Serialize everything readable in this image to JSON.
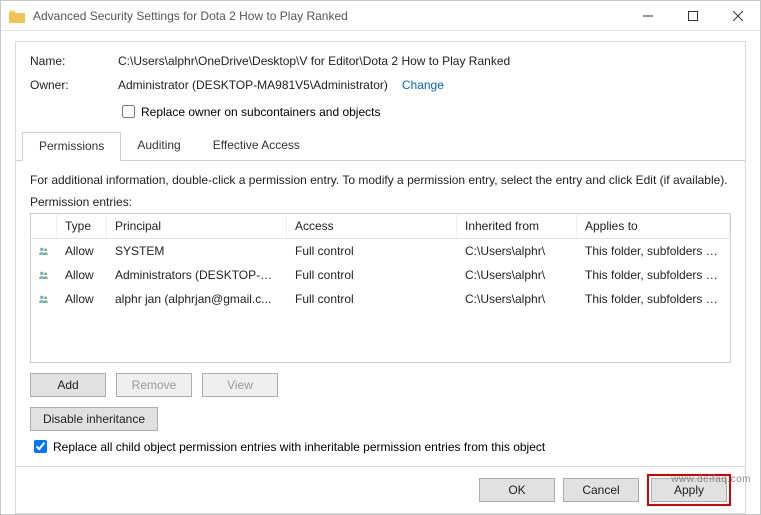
{
  "window": {
    "title": "Advanced Security Settings for Dota 2 How to Play Ranked"
  },
  "meta": {
    "name_label": "Name:",
    "name_value": "C:\\Users\\alphr\\OneDrive\\Desktop\\V for Editor\\Dota 2 How to Play Ranked",
    "owner_label": "Owner:",
    "owner_value": "Administrator (DESKTOP-MA981V5\\Administrator)",
    "change_link": "Change",
    "replace_owner_label": "Replace owner on subcontainers and objects"
  },
  "tabs": {
    "permissions": "Permissions",
    "auditing": "Auditing",
    "effective": "Effective Access"
  },
  "info_text": "For additional information, double-click a permission entry. To modify a permission entry, select the entry and click Edit (if available).",
  "entries_label": "Permission entries:",
  "columns": {
    "type": "Type",
    "principal": "Principal",
    "access": "Access",
    "inherited": "Inherited from",
    "applies": "Applies to"
  },
  "rows": [
    {
      "type": "Allow",
      "principal": "SYSTEM",
      "access": "Full control",
      "inherited": "C:\\Users\\alphr\\",
      "applies": "This folder, subfolders and files"
    },
    {
      "type": "Allow",
      "principal": "Administrators (DESKTOP-MA...",
      "access": "Full control",
      "inherited": "C:\\Users\\alphr\\",
      "applies": "This folder, subfolders and files"
    },
    {
      "type": "Allow",
      "principal": "alphr jan (alphrjan@gmail.c...",
      "access": "Full control",
      "inherited": "C:\\Users\\alphr\\",
      "applies": "This folder, subfolders and files"
    }
  ],
  "buttons": {
    "add": "Add",
    "remove": "Remove",
    "view": "View",
    "disable_inheritance": "Disable inheritance",
    "ok": "OK",
    "cancel": "Cancel",
    "apply": "Apply"
  },
  "replace_all_label": "Replace all child object permission entries with inheritable permission entries from this object",
  "watermark": "www.deifaq.com"
}
